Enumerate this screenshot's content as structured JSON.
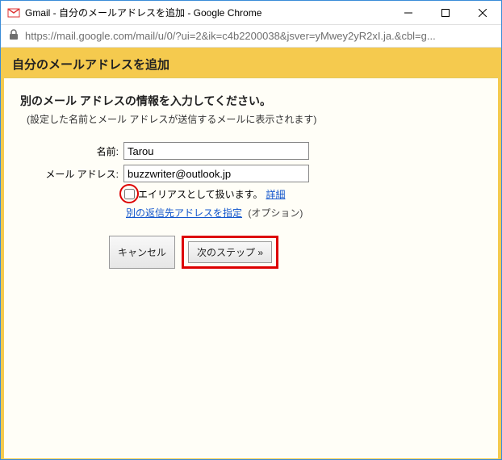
{
  "window": {
    "title": "Gmail - 自分のメールアドレスを追加 - Google Chrome"
  },
  "addressbar": {
    "url": "https://mail.google.com/mail/u/0/?ui=2&ik=c4b2200038&jsver=yMwey2yR2xI.ja.&cbl=g..."
  },
  "page": {
    "header": "自分のメールアドレスを追加",
    "heading": "別のメール アドレスの情報を入力してください。",
    "subheading": "(設定した名前とメール アドレスが送信するメールに表示されます)",
    "name_label": "名前:",
    "name_value": "Tarou",
    "email_label": "メール アドレス:",
    "email_value": "buzzwriter@outlook.jp",
    "alias_label": "エイリアスとして扱います。",
    "alias_detail_link": "詳細",
    "replyto_link": "別の返信先アドレスを指定",
    "replyto_optional": "(オプション)",
    "cancel_label": "キャンセル",
    "next_label": "次のステップ »"
  }
}
